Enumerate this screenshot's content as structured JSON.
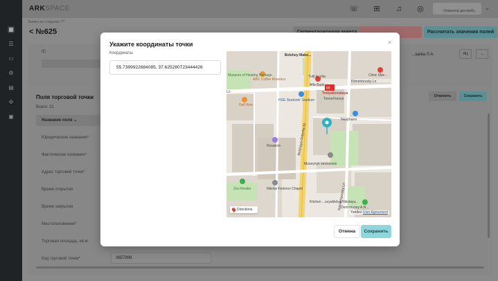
{
  "app": {
    "logo_main": "ARK",
    "logo_sub": "SPACE"
  },
  "topbar": {
    "icons": [
      "headset-icon",
      "apps-grid-icon",
      "bell-icon",
      "compass-icon"
    ],
    "user_label": "Оператор дистрибу..."
  },
  "sidebar": {
    "icons": [
      "dashboard-icon",
      "list-icon",
      "card-icon",
      "gear-icon",
      "chart-icon",
      "settings-icon",
      "calendar-icon"
    ]
  },
  "page": {
    "breadcrumb": "Заявка на создание ТТ",
    "title": "№625",
    "buttons": {
      "segment": "Сегментационная анкета",
      "calc": "Рассчитать значения полей"
    },
    "id_label": "ID",
    "owner": "...щева Л.А.",
    "owner_badge": "ЯЦ"
  },
  "fields": {
    "title": "Поля торговой точки",
    "count": "Всего: 21",
    "column_header": "Название поля",
    "cancel": "Отменить",
    "save": "Сохранить",
    "rows": [
      "Юридическое название*",
      "Фактическое название*",
      "Адрес торговой точки*",
      "Время открытия",
      "Время закрытия",
      "Местоположение*",
      "Торговая площадь, кв.м.",
      "Код торговой точки*"
    ],
    "last_value": "3657999"
  },
  "modal": {
    "title": "Укажите координаты точки",
    "coord_label": "Координаты",
    "coord_value": "55.7399922684085, 37.625280723444426",
    "cancel": "Отмена",
    "save": "Сохранить"
  },
  "map": {
    "labels": {
      "street_top": "Bolshoy Mabe...",
      "museum": "Museum of Heating Heritage",
      "abc_coffee": "ABC Coffee Roasters",
      "tutti": "Tutti la Vita",
      "alfa": "Alfa-Bank",
      "metro": "Tretyakovskaya",
      "metro_sub": "Tonnel'nooryi",
      "klimenty": "Klimentovsky Ln",
      "clinic": "Clinic Skin...",
      "hse": "HSE Students' Stadium",
      "dellarte": "Dell' Arte",
      "neopharm": "Neopharm",
      "rosatom": "Rosatom",
      "muzeynye": "Muzeynye sevissovie",
      "zoo": "Zoo theater",
      "chapel": "Nikolai Fedorov Chapel",
      "zheleznaya": "Kitchen ...svyatitelya Nikolaya...",
      "ordynka": "Bolshaya Ordynka St",
      "dom_muzey": "Dom-muzey A.N...",
      "street_left": "Tolmachyovsky Ln",
      "street_left2": "Ln"
    },
    "directions": "Directions",
    "attribution_brand": "Yandex",
    "attribution_link": "User Agreement"
  }
}
